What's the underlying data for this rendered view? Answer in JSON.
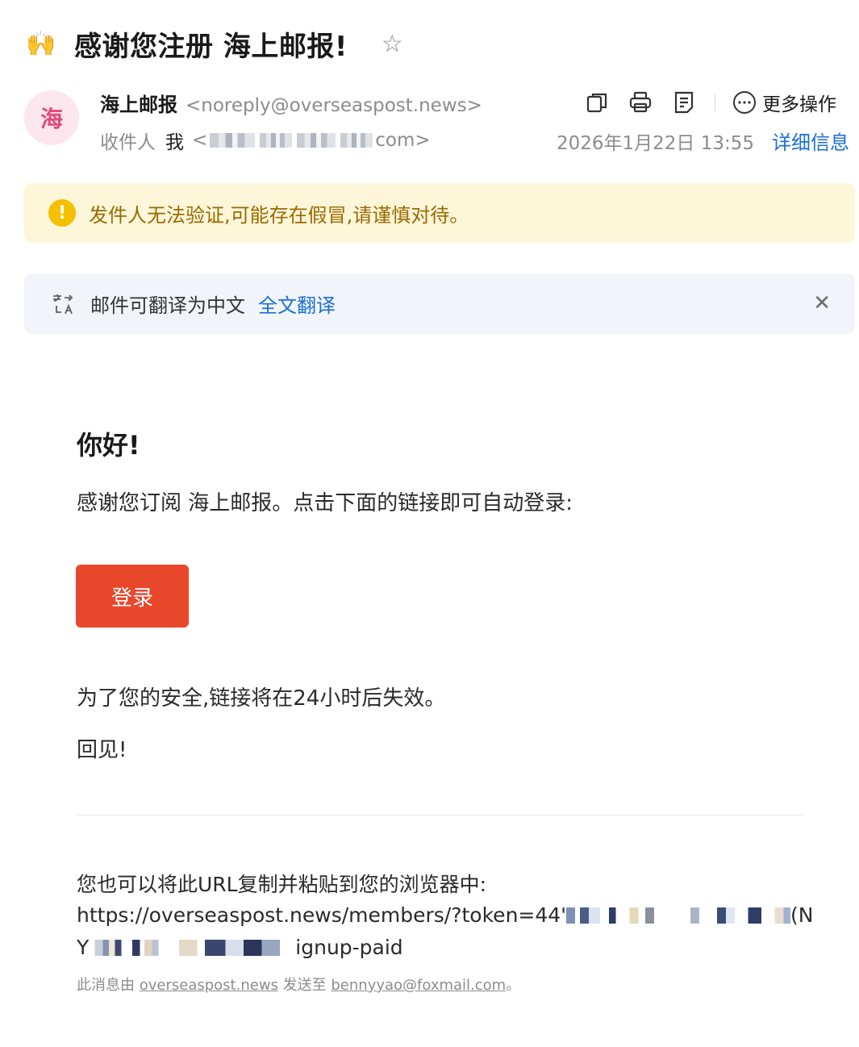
{
  "subject": {
    "emoji": "🙌",
    "title": "感谢您注册 海上邮报!",
    "star_icon": "☆"
  },
  "sender": {
    "avatar_letter": "海",
    "name": "海上邮报",
    "email": "<noreply@overseaspost.news>",
    "recipient_label": "收件人",
    "recipient_name": "我",
    "recipient_addr_prefix": "<",
    "recipient_addr_suffix": "com>"
  },
  "toolbar": {
    "more_label": "更多操作"
  },
  "meta": {
    "date": "2026年1月22日 13:55",
    "detail_link": "详细信息"
  },
  "warning": {
    "icon": "!",
    "text": "发件人无法验证,可能存在假冒,请谨慎对待。"
  },
  "translate": {
    "text": "邮件可翻译为中文",
    "link": "全文翻译",
    "close": "✕"
  },
  "body": {
    "greeting": "你好!",
    "line1": "感谢您订阅 海上邮报。点击下面的链接即可自动登录:",
    "login_button": "登录",
    "line2": "为了您的安全,链接将在24小时后失效。",
    "line3": "回见!"
  },
  "url_section": {
    "intro": "您也可以将此URL复制并粘贴到您的浏览器中:",
    "line1_prefix": "https://overseaspost.news/members/?token=44'",
    "line1_suffix": "(N",
    "line2_prefix": "Y",
    "line2_suffix": "ignup-paid"
  },
  "footer": {
    "prefix": "此消息由 ",
    "domain": "overseaspost.news",
    "middle": " 发送至 ",
    "recipient": "bennyyao@foxmail.com",
    "suffix": "。"
  },
  "colors": {
    "accent_blue": "#1a6fd6",
    "login_button": "#e8472b",
    "warning_bg": "#fdf6d9",
    "warning_text": "#9a6a00",
    "warning_icon": "#f5c000",
    "translate_bg": "#f1f5f9",
    "avatar_bg": "#fde6ee",
    "avatar_text": "#e04a7a"
  }
}
